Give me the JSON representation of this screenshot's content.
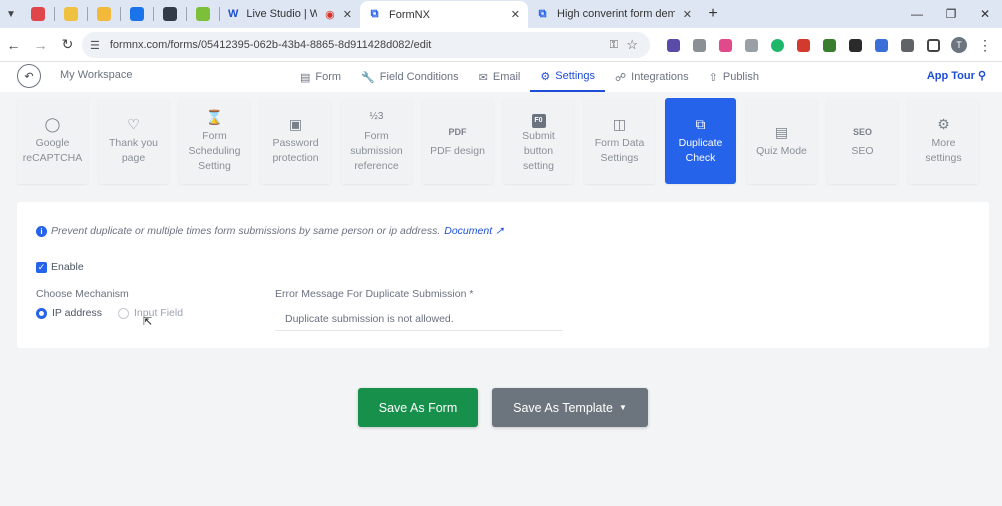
{
  "browser": {
    "tabs": [
      {
        "title": "Live Studio | Wave.video",
        "favicon": "W"
      },
      {
        "title": "FormNX",
        "favicon": "⧉",
        "active": true
      },
      {
        "title": "High converint form demo - Fo",
        "favicon": "⧉"
      }
    ],
    "url": "formnx.com/forms/05412395-062b-43b4-8865-8d911428d082/edit",
    "profile_initial": "T"
  },
  "header": {
    "workspace": "My Workspace",
    "tabs": [
      {
        "label": "Form",
        "icon": "form-icon"
      },
      {
        "label": "Field Conditions",
        "icon": "wrench-icon"
      },
      {
        "label": "Email",
        "icon": "mail-icon"
      },
      {
        "label": "Settings",
        "icon": "gear-icon",
        "active": true
      },
      {
        "label": "Integrations",
        "icon": "link-icon"
      },
      {
        "label": "Publish",
        "icon": "upload-icon"
      }
    ],
    "app_tour": "App Tour"
  },
  "settings_cards": [
    {
      "label": "Google reCAPTCHA",
      "icon": "robot-icon"
    },
    {
      "label": "Thank you page",
      "icon": "heart-icon"
    },
    {
      "label": "Form Scheduling Setting",
      "icon": "hourglass-icon"
    },
    {
      "label": "Password protection",
      "icon": "lock-icon"
    },
    {
      "label": "Form submission reference",
      "icon": "numbering-icon"
    },
    {
      "label": "PDF design",
      "icon": "pdf-icon"
    },
    {
      "label": "Submit button setting",
      "icon": "button-icon"
    },
    {
      "label": "Form Data Settings",
      "icon": "database-icon"
    },
    {
      "label": "Duplicate Check",
      "icon": "duplicate-icon",
      "active": true
    },
    {
      "label": "Quiz Mode",
      "icon": "quiz-icon"
    },
    {
      "label": "SEO",
      "icon": "seo-icon"
    },
    {
      "label": "More settings",
      "icon": "gear-icon"
    }
  ],
  "panel": {
    "info": "Prevent duplicate or multiple times form submissions by same person or ip address.",
    "doc_link": "Document",
    "enable_label": "Enable",
    "enable_checked": true,
    "mechanism_label": "Choose Mechanism",
    "mechanism_options": [
      {
        "label": "IP address",
        "selected": true
      },
      {
        "label": "Input Field",
        "selected": false
      }
    ],
    "error_label": "Error Message For Duplicate Submission *",
    "error_value": "Duplicate submission is not allowed."
  },
  "actions": {
    "save_form": "Save As Form",
    "save_template": "Save As Template"
  },
  "colors": {
    "accent": "#2563eb",
    "save_green": "#17904b",
    "template_gray": "#6c757d"
  }
}
